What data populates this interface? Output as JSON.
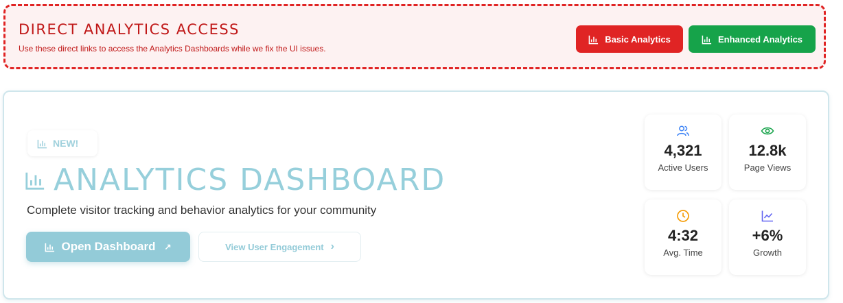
{
  "banner": {
    "title": "DIRECT ANALYTICS ACCESS",
    "subtitle": "Use these direct links to access the Analytics Dashboards while we fix the UI issues.",
    "basic_label": "Basic Analytics",
    "enhanced_label": "Enhanced Analytics",
    "button_icon": "bar-chart-icon",
    "colors": {
      "red": "#e02424",
      "green": "#16a34a",
      "background": "#fdf2f2"
    }
  },
  "card": {
    "badge_label": "NEW!",
    "title": "ANALYTICS DASHBOARD",
    "subtitle": "Complete visitor tracking and behavior analytics for your community",
    "open_label": "Open Dashboard",
    "open_arrow": "↗",
    "engage_label": "View User Engagement",
    "engage_arrow": "›",
    "accent": "#93cbd8"
  },
  "stats": [
    {
      "icon": "users-icon",
      "value": "4,321",
      "label": "Active Users",
      "color": "#3b82f6"
    },
    {
      "icon": "eye-icon",
      "value": "12.8k",
      "label": "Page Views",
      "color": "#16a34a"
    },
    {
      "icon": "clock-icon",
      "value": "4:32",
      "label": "Avg. Time",
      "color": "#f59e0b"
    },
    {
      "icon": "trend-chart-icon",
      "value": "+6%",
      "label": "Growth",
      "color": "#6366f1"
    }
  ]
}
